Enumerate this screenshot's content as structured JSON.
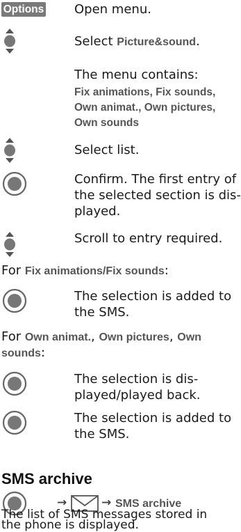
{
  "softkey": {
    "label": "Options"
  },
  "steps": {
    "open_menu": "Open menu.",
    "select_prefix": "Select ",
    "select_target": "Picture&sound",
    "select_suffix": ".",
    "menu_contains": "The menu contains:",
    "menu_items": {
      "fix_animations": "Fix animations",
      "fix_sounds": "Fix sounds",
      "own_animat": "Own animat.",
      "own_pictures": "Own pictures",
      "own_sounds": "Own sounds"
    },
    "comma": ",",
    "select_list": "Select list.",
    "confirm_line1": "Confirm. The first entry of",
    "confirm_line2": "the selected section is dis-",
    "confirm_line3": "played.",
    "scroll": "Scroll to entry required."
  },
  "for_fix": {
    "prefix": "For ",
    "label": "Fix animations/Fix sounds",
    "suffix": ":",
    "added_line1": "The selection is added to",
    "added_line2": "the SMS."
  },
  "for_own": {
    "prefix": "For ",
    "own_animat": "Own animat.",
    "own_pictures": "Own pictures",
    "own_sounds_1": "Own",
    "own_sounds_2": "sounds",
    "colon": ":",
    "displayed_line1": "The selection is dis-",
    "displayed_line2": "played/played back.",
    "added_line1": "The selection is added to",
    "added_line2": "the SMS."
  },
  "sms_archive": {
    "title": "SMS archive",
    "path_label": "SMS archive",
    "arrow": "→",
    "desc_line1": "The list of SMS messages stored in",
    "desc_line2": "the phone is displayed."
  },
  "icons": {
    "joystick": "navigation-key-icon",
    "center": "center-key-icon",
    "envelope": "message-icon"
  }
}
